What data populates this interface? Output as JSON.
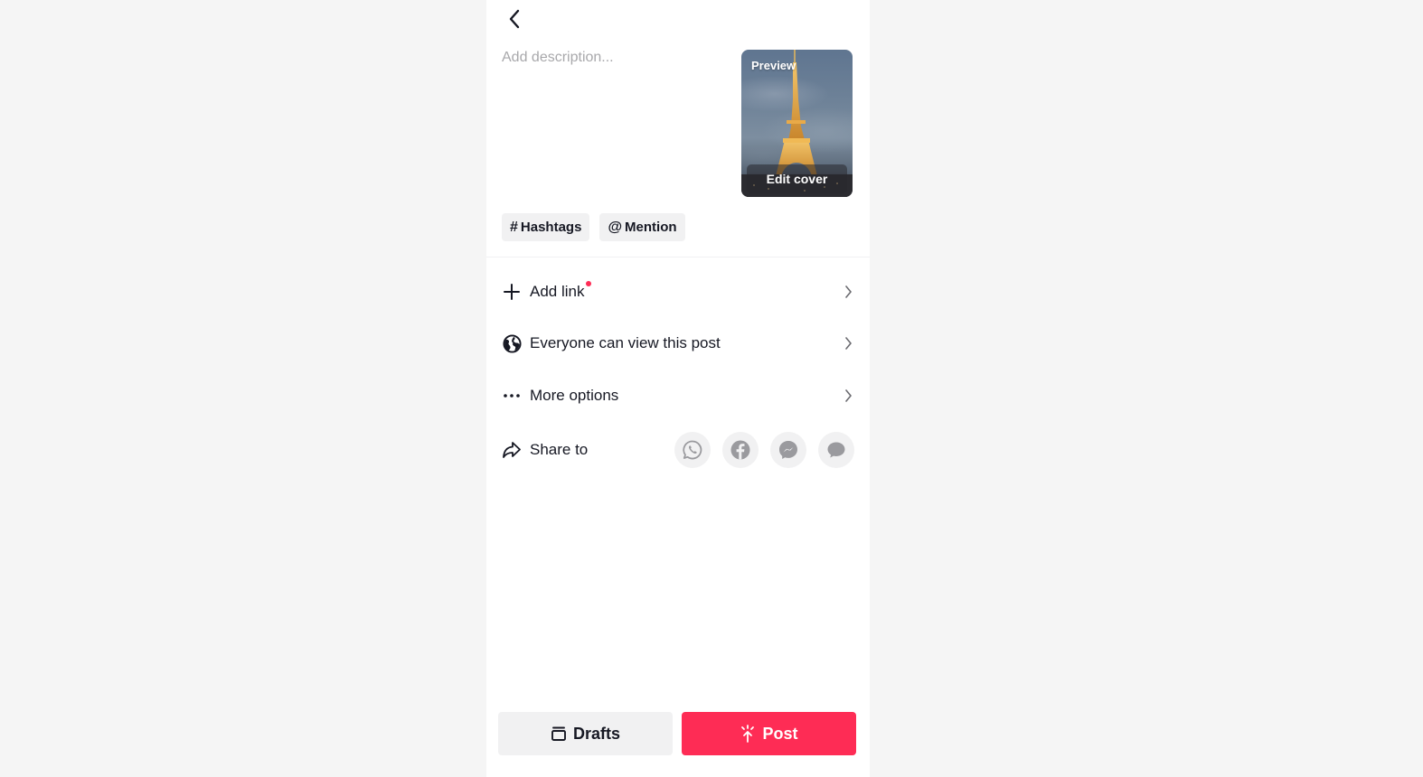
{
  "header": {
    "back_icon": "chevron-left-icon"
  },
  "description": {
    "placeholder": "Add description...",
    "value": ""
  },
  "cover": {
    "preview_label": "Preview",
    "edit_label": "Edit cover"
  },
  "chips": [
    {
      "symbol": "#",
      "label": "Hashtags",
      "icon": "hashtag-icon"
    },
    {
      "symbol": "@",
      "label": "Mention",
      "icon": "at-icon"
    }
  ],
  "options": [
    {
      "label": "Add link",
      "icon": "plus-icon",
      "has_dot": true
    },
    {
      "label": "Everyone can view this post",
      "icon": "globe-icon"
    },
    {
      "label": "More options",
      "icon": "more-dots-icon"
    }
  ],
  "share": {
    "label": "Share to",
    "icon": "share-arrow-icon",
    "targets": [
      {
        "name": "WhatsApp",
        "icon": "whatsapp-icon"
      },
      {
        "name": "Facebook",
        "icon": "facebook-icon"
      },
      {
        "name": "Messenger",
        "icon": "messenger-icon"
      },
      {
        "name": "Messages",
        "icon": "message-bubble-icon"
      }
    ]
  },
  "footer": {
    "drafts_label": "Drafts",
    "post_label": "Post"
  },
  "colors": {
    "accent": "#fe2c55",
    "background": "#f5f5f5",
    "chip_bg": "#f1f1f2",
    "text": "#161823",
    "placeholder": "#a8a8ab"
  }
}
